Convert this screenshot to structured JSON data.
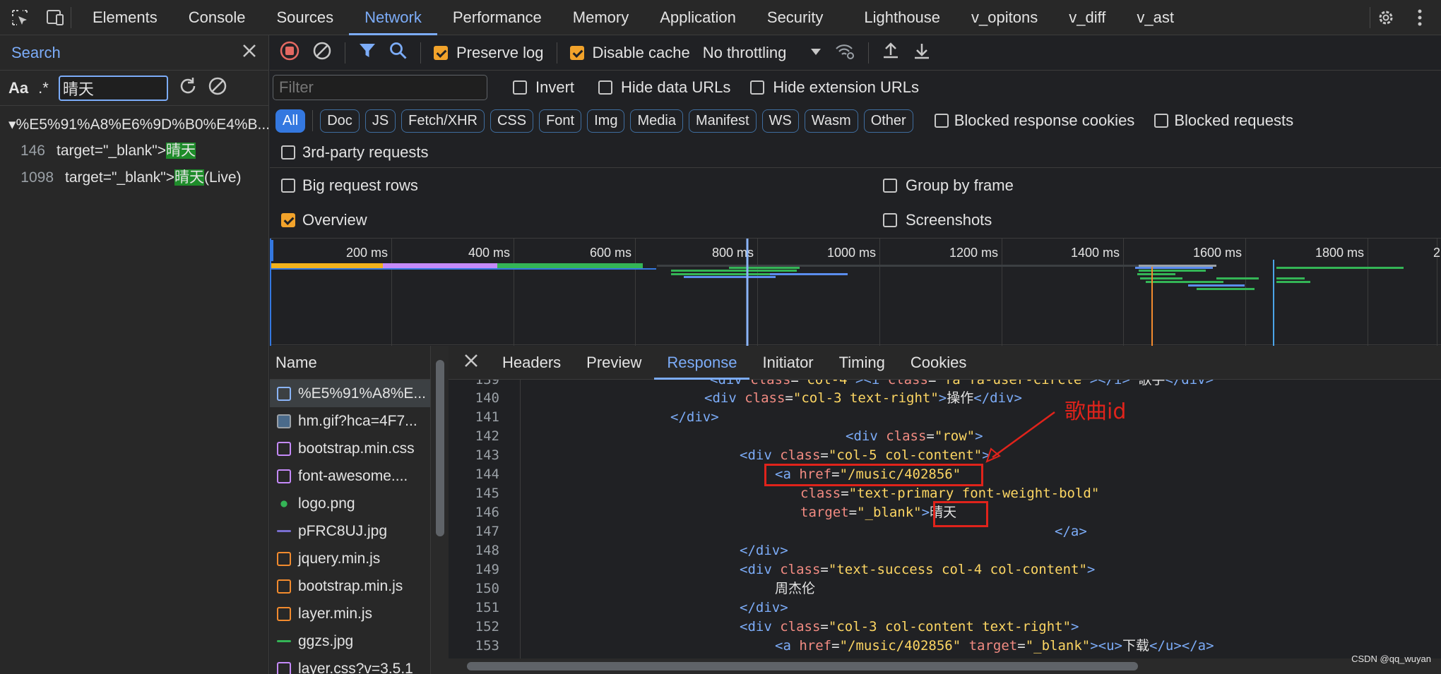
{
  "topbar": {
    "tabs": [
      "Elements",
      "Console",
      "Sources",
      "Network",
      "Performance",
      "Memory",
      "Application",
      "Security",
      "Lighthouse",
      "v_opitons",
      "v_diff",
      "v_ast"
    ],
    "active": "Network",
    "icons": [
      "inspect-icon",
      "device-toolbar-icon",
      "settings-gear-icon",
      "more-menu-icon"
    ]
  },
  "search": {
    "title": "Search",
    "case_label": "Aa",
    "regex_label": ".*",
    "query": "晴天",
    "file": "▾%E5%91%A8%E6%9D%B0%E4%B...",
    "results": [
      {
        "line": "146",
        "prefix": "target=\"_blank\">",
        "match": "晴天",
        "suffix": ""
      },
      {
        "line": "1098",
        "prefix": "target=\"_blank\">",
        "match": "晴天",
        "suffix": "(Live)"
      }
    ]
  },
  "toolbar": {
    "preserve_log": "Preserve log",
    "disable_cache": "Disable cache",
    "throttling": "No throttling",
    "filter_placeholder": "Filter",
    "invert": "Invert",
    "hide_data_urls": "Hide data URLs",
    "hide_extension_urls": "Hide extension URLs",
    "types": [
      "All",
      "Doc",
      "JS",
      "Fetch/XHR",
      "CSS",
      "Font",
      "Img",
      "Media",
      "Manifest",
      "WS",
      "Wasm",
      "Other"
    ],
    "blocked_cookies": "Blocked response cookies",
    "blocked_requests": "Blocked requests",
    "third_party": "3rd-party requests",
    "big_rows": "Big request rows",
    "group_by_frame": "Group by frame",
    "overview": "Overview",
    "screenshots": "Screenshots"
  },
  "timeline": {
    "ticks": [
      "200 ms",
      "400 ms",
      "600 ms",
      "800 ms",
      "1000 ms",
      "1200 ms",
      "1400 ms",
      "1600 ms",
      "1800 ms",
      "2"
    ],
    "colors": {
      "waiting": "#f2b21b",
      "dns": "#c58af9",
      "download": "#34b556",
      "blue": "#5b8dee"
    }
  },
  "names": {
    "header": "Name",
    "items": [
      {
        "name": "%E5%91%A8%E...",
        "kind": "doc"
      },
      {
        "name": "hm.gif?hca=4F7...",
        "kind": "img"
      },
      {
        "name": "bootstrap.min.css",
        "kind": "css"
      },
      {
        "name": "font-awesome....",
        "kind": "css"
      },
      {
        "name": "logo.png",
        "kind": "img"
      },
      {
        "name": "pFRC8UJ.jpg",
        "kind": "img"
      },
      {
        "name": "jquery.min.js",
        "kind": "js"
      },
      {
        "name": "bootstrap.min.js",
        "kind": "js"
      },
      {
        "name": "layer.min.js",
        "kind": "js"
      },
      {
        "name": "ggzs.jpg",
        "kind": "img"
      },
      {
        "name": "layer.css?v=3.5.1",
        "kind": "css"
      }
    ]
  },
  "details": {
    "tabs": [
      "Headers",
      "Preview",
      "Response",
      "Initiator",
      "Timing",
      "Cookies"
    ],
    "active": "Response"
  },
  "annotation": "歌曲id",
  "watermark": "CSDN @qq_wuyan"
}
